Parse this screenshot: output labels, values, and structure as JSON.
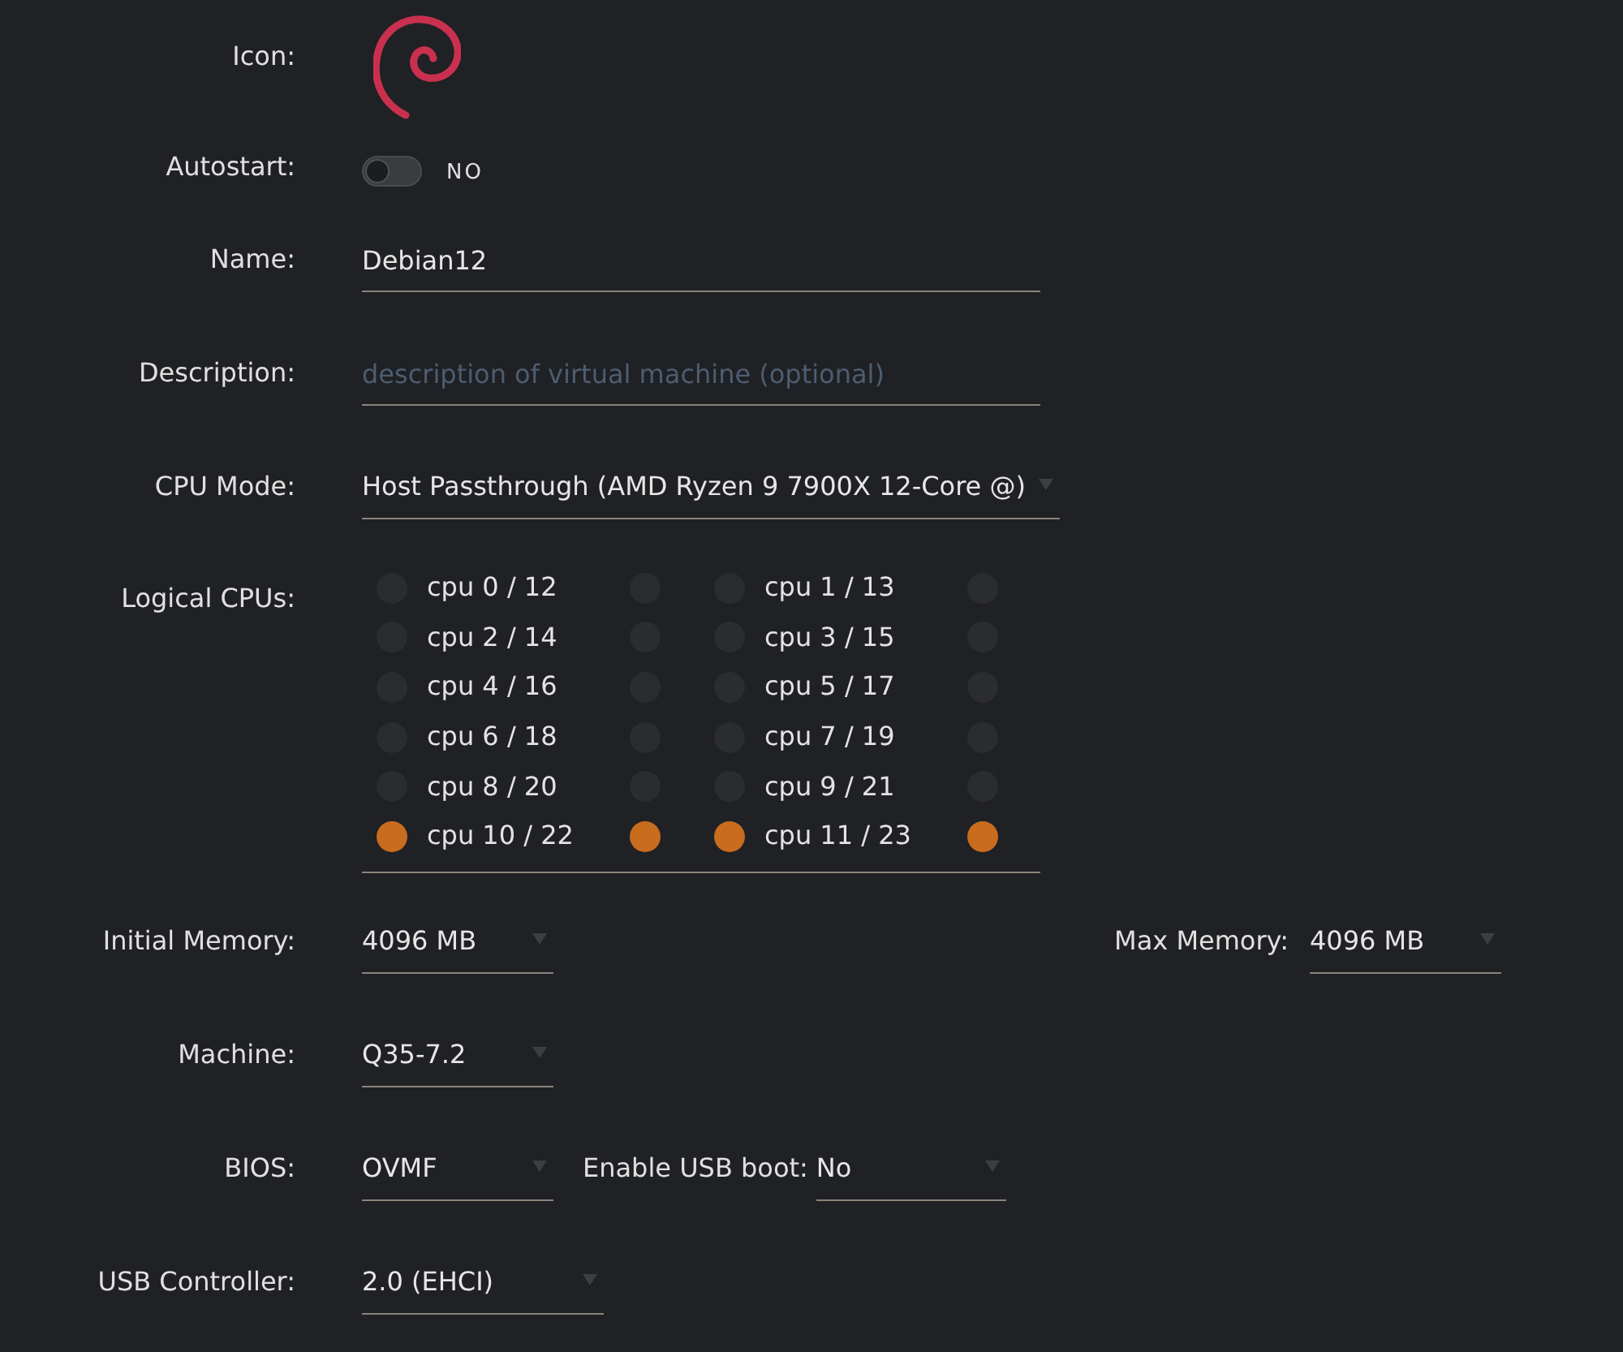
{
  "icon": {
    "label": "Icon:"
  },
  "autostart": {
    "label": "Autostart:",
    "on": false,
    "state_text": "NO"
  },
  "name": {
    "label": "Name:",
    "value": "Debian12"
  },
  "description": {
    "label": "Description:",
    "placeholder": "description of virtual machine (optional)"
  },
  "cpu_mode": {
    "label": "CPU Mode:",
    "value": "Host Passthrough (AMD Ryzen 9 7900X 12-Core @)"
  },
  "logical_cpus": {
    "label": "Logical CPUs:",
    "cpus": [
      {
        "label": "cpu 0 / 12",
        "threads": [
          {
            "checked": false
          },
          {
            "checked": false
          }
        ]
      },
      {
        "label": "cpu 1 / 13",
        "threads": [
          {
            "checked": false
          },
          {
            "checked": false
          }
        ]
      },
      {
        "label": "cpu 2 / 14",
        "threads": [
          {
            "checked": false
          },
          {
            "checked": false
          }
        ]
      },
      {
        "label": "cpu 3 / 15",
        "threads": [
          {
            "checked": false
          },
          {
            "checked": false
          }
        ]
      },
      {
        "label": "cpu 4 / 16",
        "threads": [
          {
            "checked": false
          },
          {
            "checked": false
          }
        ]
      },
      {
        "label": "cpu 5 / 17",
        "threads": [
          {
            "checked": false
          },
          {
            "checked": false
          }
        ]
      },
      {
        "label": "cpu 6 / 18",
        "threads": [
          {
            "checked": false
          },
          {
            "checked": false
          }
        ]
      },
      {
        "label": "cpu 7 / 19",
        "threads": [
          {
            "checked": false
          },
          {
            "checked": false
          }
        ]
      },
      {
        "label": "cpu 8 / 20",
        "threads": [
          {
            "checked": false
          },
          {
            "checked": false
          }
        ]
      },
      {
        "label": "cpu 9 / 21",
        "threads": [
          {
            "checked": false
          },
          {
            "checked": false
          }
        ]
      },
      {
        "label": "cpu 10 / 22",
        "threads": [
          {
            "checked": true
          },
          {
            "checked": true
          }
        ]
      },
      {
        "label": "cpu 11 / 23",
        "threads": [
          {
            "checked": true
          },
          {
            "checked": true
          }
        ]
      }
    ]
  },
  "initial_memory": {
    "label": "Initial Memory:",
    "value": "4096 MB"
  },
  "max_memory": {
    "label": "Max Memory:",
    "value": "4096 MB"
  },
  "machine": {
    "label": "Machine:",
    "value": "Q35-7.2"
  },
  "bios": {
    "label": "BIOS:",
    "value": "OVMF"
  },
  "usb_boot": {
    "label": "Enable USB boot:",
    "value": "No"
  },
  "usb_controller": {
    "label": "USB Controller:",
    "value": "2.0 (EHCI)"
  }
}
